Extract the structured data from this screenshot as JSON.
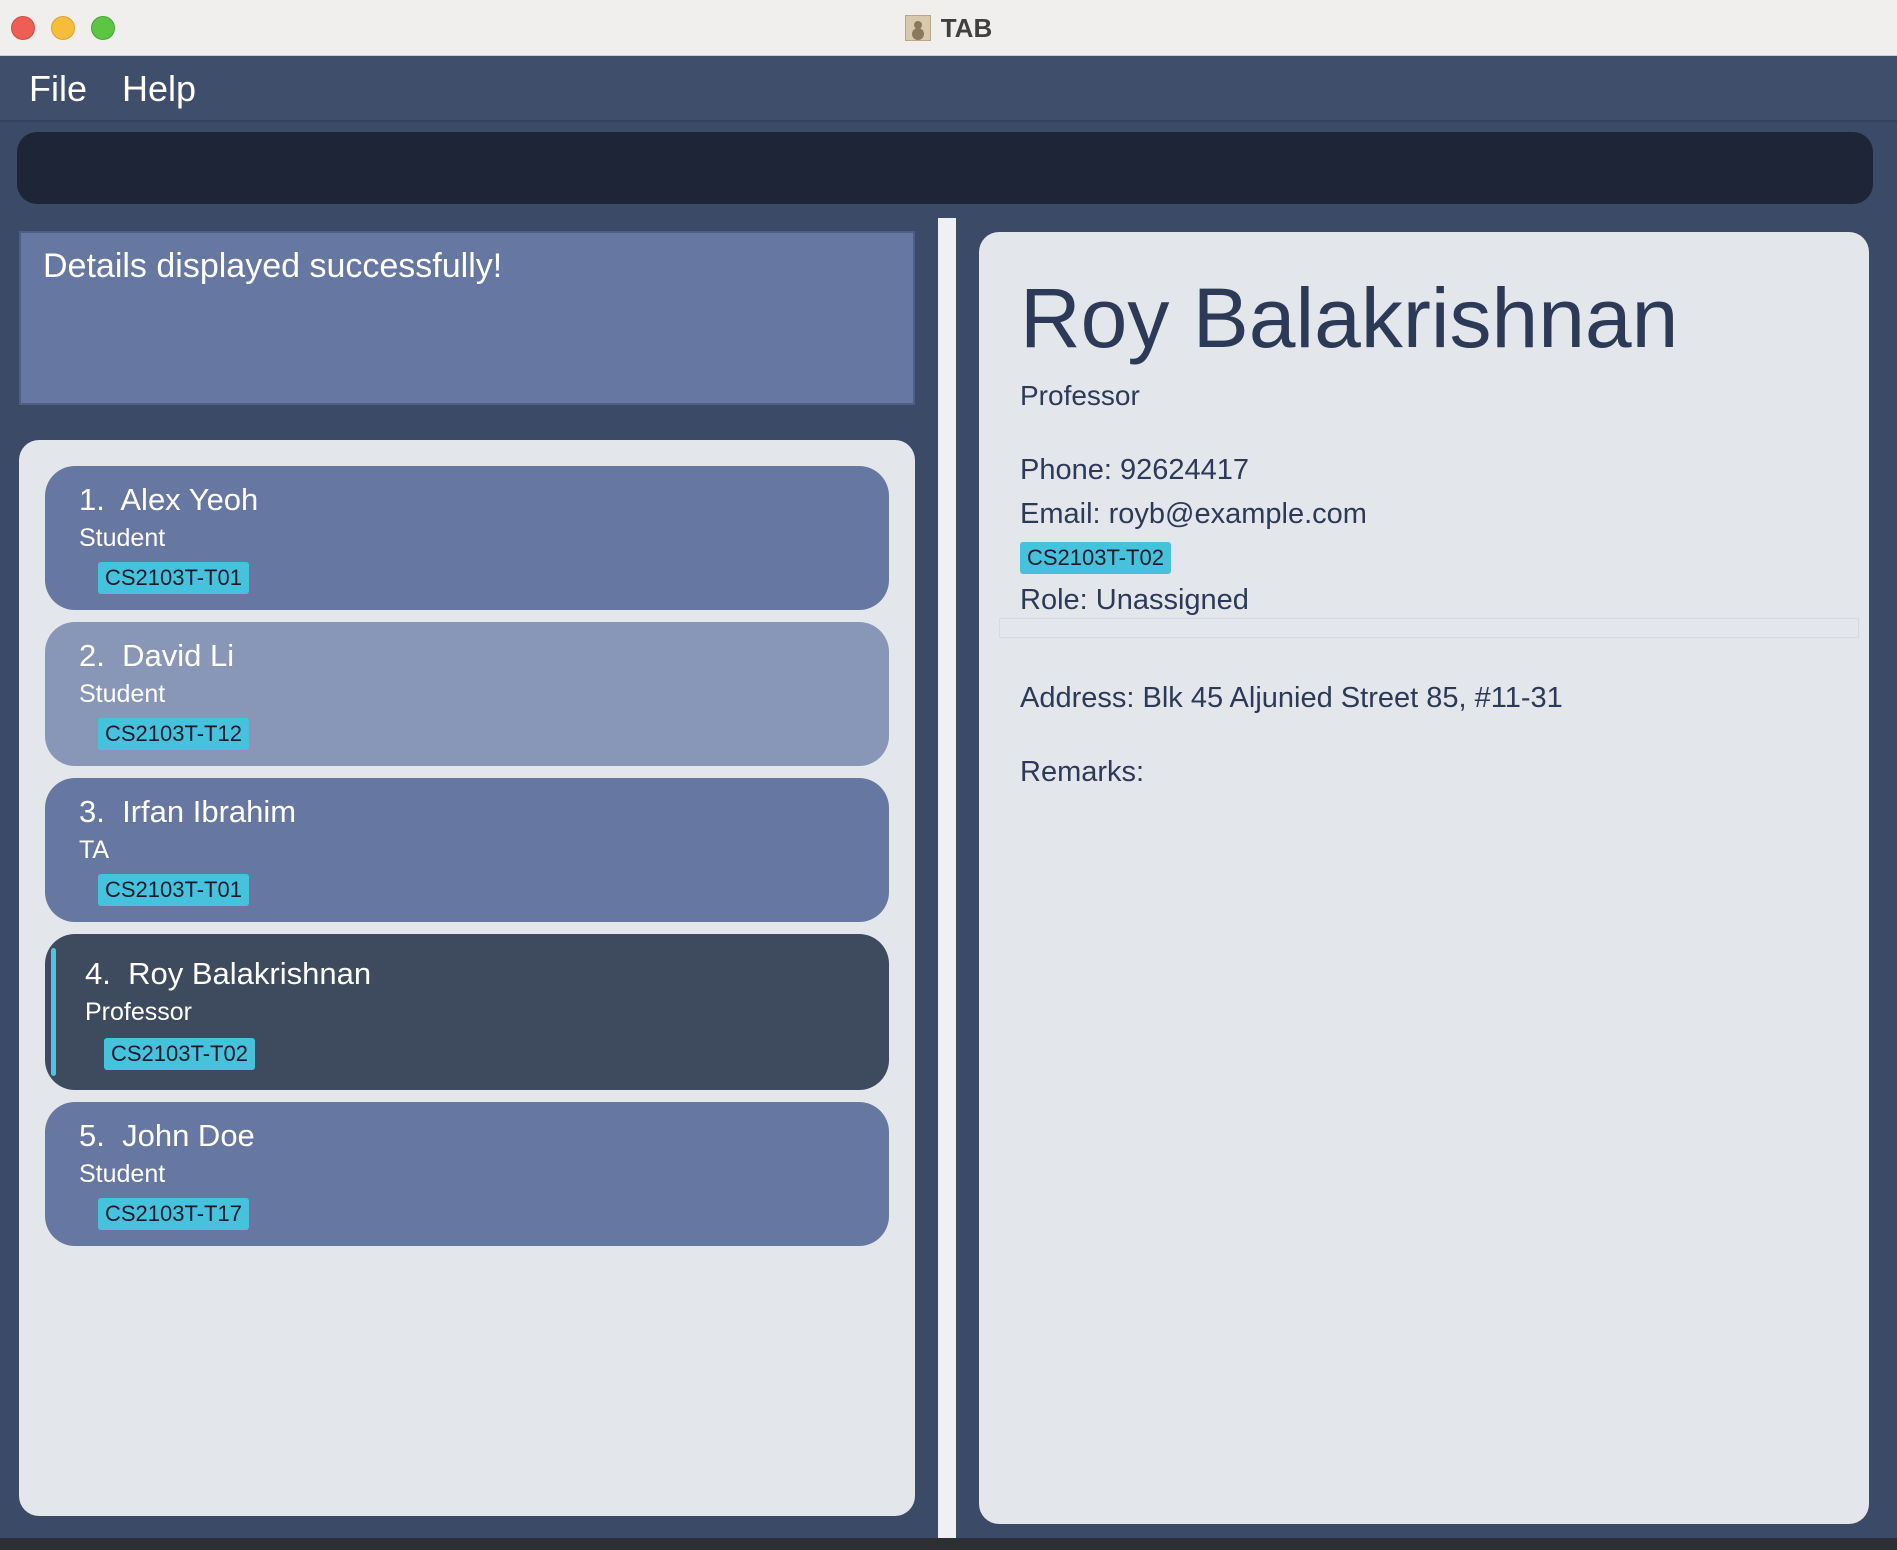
{
  "window": {
    "title": "TAB"
  },
  "menu": {
    "file": "File",
    "help": "Help"
  },
  "command": {
    "value": ""
  },
  "result": {
    "message": "Details displayed successfully!"
  },
  "persons": [
    {
      "index": "1.",
      "name": "Alex Yeoh",
      "role": "Student",
      "tag": "CS2103T-T01"
    },
    {
      "index": "2.",
      "name": "David Li",
      "role": "Student",
      "tag": "CS2103T-T12"
    },
    {
      "index": "3.",
      "name": "Irfan Ibrahim",
      "role": "TA",
      "tag": "CS2103T-T01"
    },
    {
      "index": "4.",
      "name": "Roy Balakrishnan",
      "role": "Professor",
      "tag": "CS2103T-T02"
    },
    {
      "index": "5.",
      "name": "John Doe",
      "role": "Student",
      "tag": "CS2103T-T17"
    }
  ],
  "detail": {
    "name": "Roy Balakrishnan",
    "role": "Professor",
    "phone": "Phone: 92624417",
    "email": "Email: royb@example.com",
    "tag": "CS2103T-T02",
    "assigned_role": "Role: Unassigned",
    "address": "Address: Blk 45 Aljunied Street 85, #11-31",
    "remarks": "Remarks:"
  },
  "colors": {
    "background": "#3b4a66",
    "card": "#6677a2",
    "card_hover": "#8897b8",
    "card_selected": "#3e4a5e",
    "tag": "#47c2dd",
    "panel": "#e3e6eb",
    "command_box": "#1e2537"
  }
}
